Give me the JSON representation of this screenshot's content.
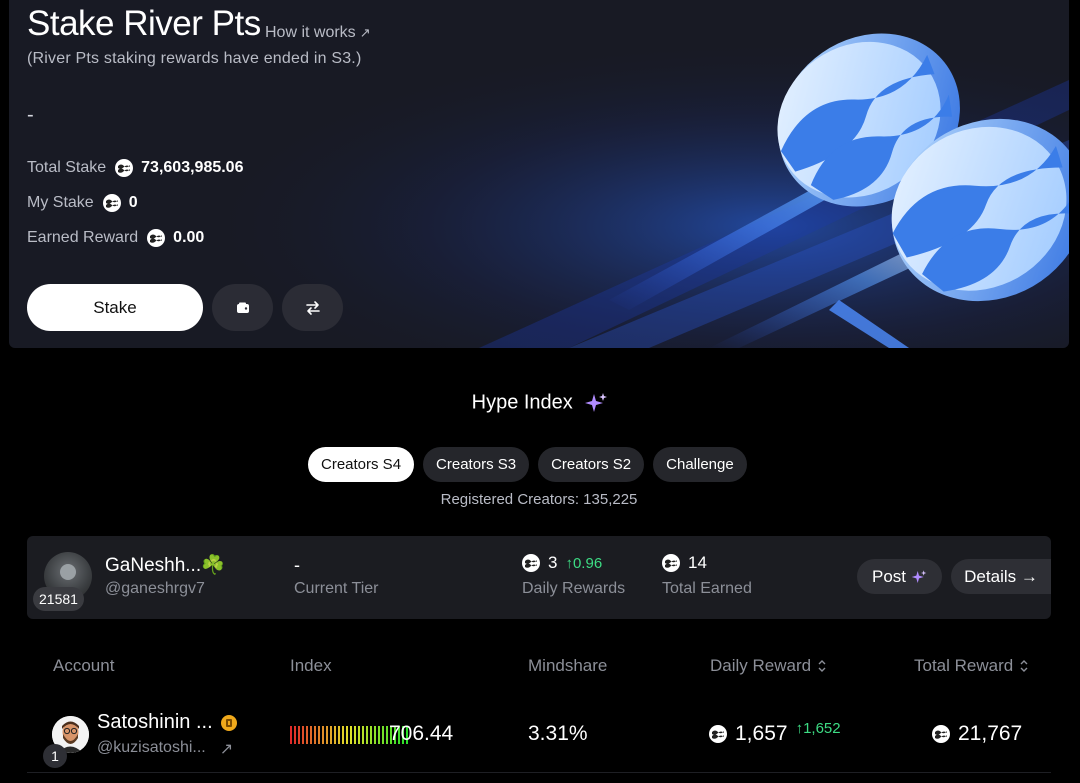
{
  "stake": {
    "title": "Stake River Pts",
    "how_link": "How it works",
    "how_link_arrow": "↗",
    "note": "(River Pts staking rewards have ended in S3.)",
    "value_placeholder": "-",
    "stats": [
      {
        "label": "Total Stake",
        "value": "73,603,985.06"
      },
      {
        "label": "My Stake",
        "value": "0"
      },
      {
        "label": "Earned Reward",
        "value": "0.00"
      }
    ],
    "stake_button": "Stake",
    "wallet_icon": "wallet-icon",
    "swap_icon": "swap-arrows-icon"
  },
  "hype": {
    "title": "Hype Index",
    "sparkle_icon": "sparkle-icon",
    "tabs": [
      "Creators S4",
      "Creators S3",
      "Creators S2",
      "Challenge"
    ],
    "active_tab": "Creators S4",
    "registered": "Registered Creators: 135,225"
  },
  "me": {
    "rank": "21581",
    "name": "GaNeshh...☘️",
    "handle": "@ganeshrgv7",
    "tier_value": "-",
    "tier_label": "Current Tier",
    "daily_rewards": "3",
    "daily_change": "↑0.96",
    "daily_label": "Daily Rewards",
    "total_earned": "14",
    "total_label": "Total Earned",
    "post_button": "Post",
    "details_button": "Details →"
  },
  "table": {
    "headers": {
      "account": "Account",
      "index": "Index",
      "mindshare": "Mindshare",
      "daily_reward": "Daily Reward",
      "total_reward": "Total Reward"
    },
    "sort_icon": "sort-updown-icon",
    "rows": [
      {
        "rank": "1",
        "name": "Satoshinin ...",
        "handle": "@kuzisatoshi...",
        "handle_arrow": "↗",
        "index": "706.44",
        "mindshare": "3.31%",
        "daily_reward": "1,657",
        "daily_change": "↑1,652",
        "total_reward": "21,767"
      }
    ]
  },
  "colors": {
    "accent_blue": "#2f7bff",
    "up_green": "#3ddc84",
    "verify_orange": "#f0a91b",
    "sparkle_purple": "#b18cff"
  }
}
